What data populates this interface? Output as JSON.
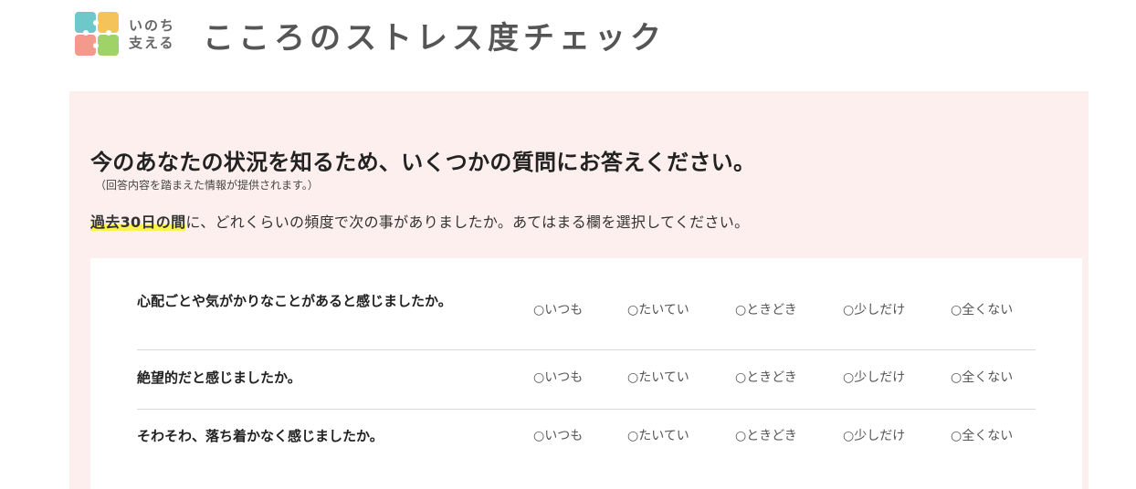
{
  "header": {
    "logo_line1": "いのち",
    "logo_line2": "支える",
    "title": "こころのストレス度チェック"
  },
  "panel": {
    "heading": "今のあなたの状況を知るため、いくつかの質問にお答えください。",
    "sub_note": "（回答内容を踏まえた情報が提供されます。）",
    "instruction_highlight": "過去30日の間",
    "instruction_rest": "に、どれくらいの頻度で次の事がありましたか。あてはまる欄を選択してください。"
  },
  "options": [
    "○いつも",
    "○たいてい",
    "○ときどき",
    "○少しだけ",
    "○全くない"
  ],
  "questions": [
    {
      "text": "心配ごとや気がかりなことがあると感じましたか。"
    },
    {
      "text": "絶望的だと感じましたか。"
    },
    {
      "text": "そわそわ、落ち着かなく感じましたか。"
    }
  ],
  "colors": {
    "panel_bg": "#fdefee",
    "highlight": "#fdf34c"
  }
}
